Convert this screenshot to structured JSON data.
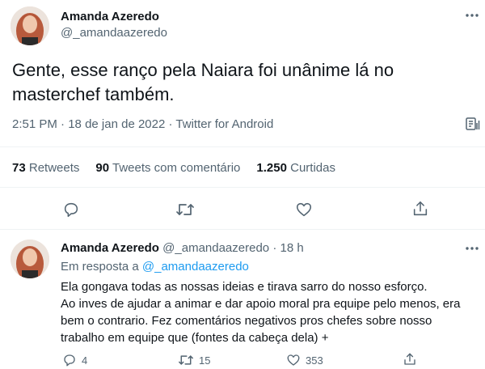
{
  "main_tweet": {
    "author_name": "Amanda Azeredo",
    "author_handle": "@_amandaazeredo",
    "text_line1": "Gente, esse ranço pela Naiara foi unânime lá no",
    "text_line2": "masterchef também.",
    "time": "2:51 PM",
    "sep1": "·",
    "date": "18 de jan de 2022",
    "sep2": "·",
    "source": "Twitter for Android",
    "stats": {
      "retweets_count": "73",
      "retweets_label": "Retweets",
      "quotes_count": "90",
      "quotes_label": "Tweets com comentário",
      "likes_count": "1.250",
      "likes_label": "Curtidas"
    }
  },
  "reply": {
    "author_name": "Amanda Azeredo",
    "author_handle": "@_amandaazeredo",
    "sep": "·",
    "age": "18 h",
    "reply_to_prefix": "Em resposta a",
    "reply_to_handle": "@_amandaazeredo",
    "line1": "Ela gongava todas as nossas ideias e tirava sarro do nosso esforço.",
    "line2": "Ao inves de ajudar a animar e dar apoio moral pra equipe pelo menos, era",
    "line3": "bem o contrario. Fez comentários negativos pros chefes sobre nosso",
    "line4": "trabalho em equipe que (fontes da cabeça dela) +",
    "reply_count": "4",
    "retweet_count": "15",
    "like_count": "353"
  },
  "colors": {
    "text": "#0f1419",
    "muted": "#536471",
    "link": "#1d9bf0",
    "divider": "#eff3f4"
  },
  "icons": [
    "more-icon",
    "analytics-icon",
    "reply-icon",
    "retweet-icon",
    "like-icon",
    "share-icon"
  ]
}
